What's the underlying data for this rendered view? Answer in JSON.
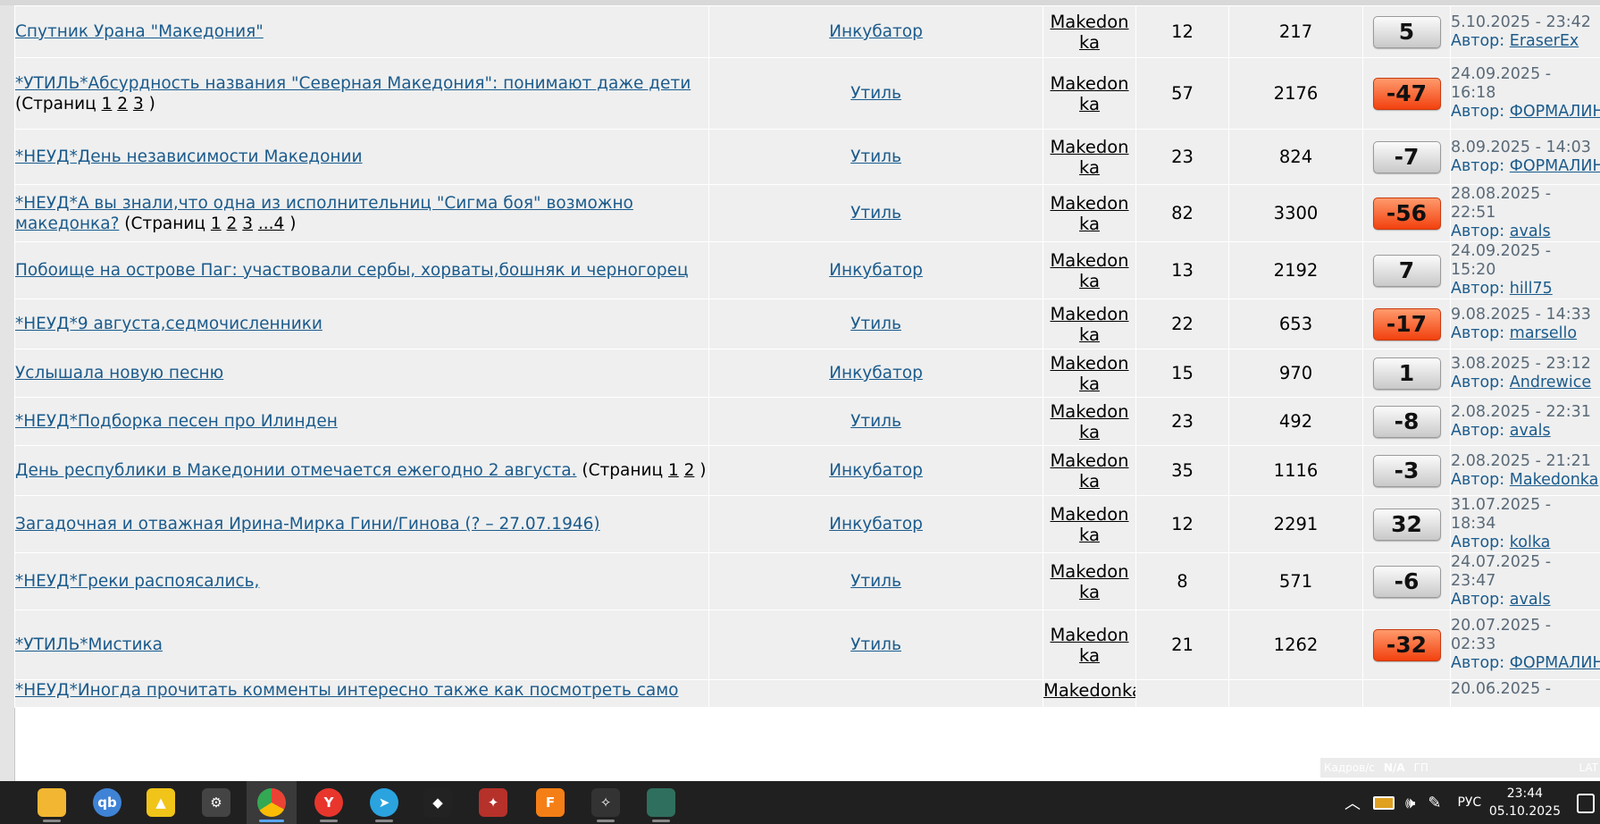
{
  "rows": [
    {
      "title": "Спутник Урана \"Македония\"",
      "pages_label": "",
      "pages": [],
      "forum": "Инкубатор",
      "author": "Makedonka",
      "replies": "12",
      "views": "217",
      "rating": "5",
      "rating_style": "neutral",
      "last_date": "5.10.2025 - 23:42",
      "last_author_label": "Автор:",
      "last_author": "EraserEx"
    },
    {
      "title": "*УТИЛЬ*Абсурдность названия \"Северная Македония\": понимают даже дети",
      "pages_label": "(Страниц",
      "pages": [
        "1",
        "2",
        "3"
      ],
      "forum": "Утиль",
      "author": "Makedonka",
      "replies": "57",
      "views": "2176",
      "rating": "-47",
      "rating_style": "negative",
      "last_date": "24.09.2025 - 16:18",
      "last_author_label": "Автор:",
      "last_author": "ФОРМАЛИН"
    },
    {
      "title": "*НЕУД*День независимости Македонии",
      "pages_label": "",
      "pages": [],
      "forum": "Утиль",
      "author": "Makedonka",
      "replies": "23",
      "views": "824",
      "rating": "-7",
      "rating_style": "neutral",
      "last_date": "8.09.2025 - 14:03",
      "last_author_label": "Автор:",
      "last_author": "ФОРМАЛИН"
    },
    {
      "title": "*НЕУД*А вы знали,что одна из исполнительниц \"Сигма боя\" возможно македонка?",
      "pages_label": "(Страниц",
      "pages": [
        "1",
        "2",
        "3",
        "...4"
      ],
      "forum": "Утиль",
      "author": "Makedonka",
      "replies": "82",
      "views": "3300",
      "rating": "-56",
      "rating_style": "negative",
      "last_date": "28.08.2025 - 22:51",
      "last_author_label": "Автор:",
      "last_author": "avals"
    },
    {
      "title": "Побоище на острове Паг: участвовали сербы, хорваты,бошняк и черногорец",
      "pages_label": "",
      "pages": [],
      "forum": "Инкубатор",
      "author": "Makedonka",
      "replies": "13",
      "views": "2192",
      "rating": "7",
      "rating_style": "neutral",
      "last_date": "24.09.2025 - 15:20",
      "last_author_label": "Автор:",
      "last_author": "hill75"
    },
    {
      "title": "*НЕУД*9 августа,седмочисленники",
      "pages_label": "",
      "pages": [],
      "forum": "Утиль",
      "author": "Makedonka",
      "replies": "22",
      "views": "653",
      "rating": "-17",
      "rating_style": "negative",
      "last_date": "9.08.2025 - 14:33",
      "last_author_label": "Автор:",
      "last_author": "marsello"
    },
    {
      "title": "Услышала новую песню",
      "pages_label": "",
      "pages": [],
      "forum": "Инкубатор",
      "author": "Makedonka",
      "replies": "15",
      "views": "970",
      "rating": "1",
      "rating_style": "neutral",
      "last_date": "3.08.2025 - 23:12",
      "last_author_label": "Автор:",
      "last_author": "Andrewice"
    },
    {
      "title": "*НЕУД*Подборка песен про Илинден",
      "pages_label": "",
      "pages": [],
      "forum": "Утиль",
      "author": "Makedonka",
      "replies": "23",
      "views": "492",
      "rating": "-8",
      "rating_style": "neutral",
      "last_date": "2.08.2025 - 22:31",
      "last_author_label": "Автор:",
      "last_author": "avals"
    },
    {
      "title": "День республики в Македонии отмечается ежегодно 2 августа.",
      "pages_label": "(Страниц",
      "pages": [
        "1",
        "2"
      ],
      "forum": "Инкубатор",
      "author": "Makedonka",
      "replies": "35",
      "views": "1116",
      "rating": "-3",
      "rating_style": "neutral",
      "last_date": "2.08.2025 - 21:21",
      "last_author_label": "Автор:",
      "last_author": "Makedonka"
    },
    {
      "title": "Загадочная и отважная Ирина-Мирка Гини/Гинова (? – 27.07.1946)",
      "pages_label": "",
      "pages": [],
      "forum": "Инкубатор",
      "author": "Makedonka",
      "replies": "12",
      "views": "2291",
      "rating": "32",
      "rating_style": "neutral",
      "last_date": "31.07.2025 - 18:34",
      "last_author_label": "Автор:",
      "last_author": "kolka"
    },
    {
      "title": "*НЕУД*Греки распоясались,",
      "pages_label": "",
      "pages": [],
      "forum": "Утиль",
      "author": "Makedonka",
      "replies": "8",
      "views": "571",
      "rating": "-6",
      "rating_style": "neutral",
      "last_date": "24.07.2025 - 23:47",
      "last_author_label": "Автор:",
      "last_author": "avals"
    },
    {
      "title": "*УТИЛЬ*Мистика",
      "pages_label": "",
      "pages": [],
      "forum": "Утиль",
      "author": "Makedonka",
      "replies": "21",
      "views": "1262",
      "rating": "-32",
      "rating_style": "negative",
      "last_date": "20.07.2025 - 02:33",
      "last_author_label": "Автор:",
      "last_author": "ФОРМАЛИН"
    }
  ],
  "partial_row": {
    "title": "*НЕУД*Иногда прочитать комменты интересно также как посмотреть само",
    "author": "Makedonka",
    "last_date": "20.06.2025 -"
  },
  "overlay": {
    "left": "Кадров/с",
    "na": "N/A",
    "gpu": "ГП",
    "lat": "LAT"
  },
  "taskbar": {
    "apps": [
      {
        "name": "file-explorer-icon",
        "label": ""
      },
      {
        "name": "qbittorrent-icon",
        "label": "qb"
      },
      {
        "name": "arc-app-icon",
        "label": "▲"
      },
      {
        "name": "steelseries-icon",
        "label": "⚙"
      },
      {
        "name": "chrome-icon",
        "label": ""
      },
      {
        "name": "yandex-browser-icon",
        "label": "Y"
      },
      {
        "name": "telegram-icon",
        "label": "➤"
      },
      {
        "name": "mask-app-icon",
        "label": "◆"
      },
      {
        "name": "fighter-app-icon",
        "label": "✦"
      },
      {
        "name": "fl-studio-icon",
        "label": "F"
      },
      {
        "name": "eagle-app-icon",
        "label": "✧"
      },
      {
        "name": "window-app-icon",
        "label": ""
      }
    ],
    "lang": "РУС",
    "time": "23:44",
    "date": "05.10.2025"
  }
}
